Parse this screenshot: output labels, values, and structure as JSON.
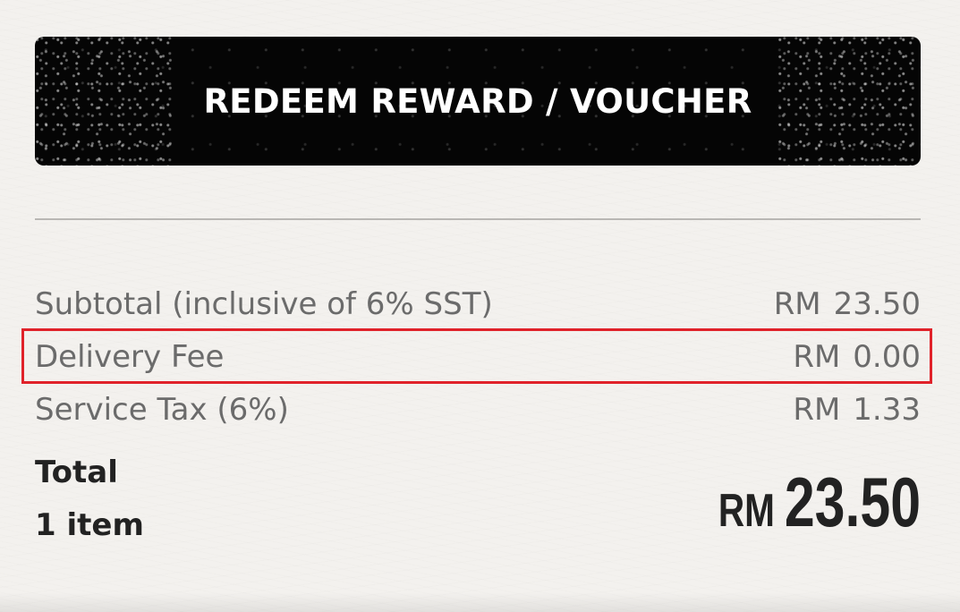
{
  "redeem": {
    "label": "REDEEM REWARD / VOUCHER"
  },
  "summary": {
    "subtotal": {
      "label": "Subtotal (inclusive of 6% SST)",
      "currency": "RM",
      "amount": "23.50"
    },
    "delivery_fee": {
      "label": "Delivery Fee",
      "currency": "RM",
      "amount": "0.00"
    },
    "service_tax": {
      "label": "Service Tax (6%)",
      "currency": "RM",
      "amount": "1.33"
    }
  },
  "total": {
    "label": "Total",
    "item_count": "1 item",
    "currency": "RM",
    "amount": "23.50"
  },
  "colors": {
    "background": "#f3f1ee",
    "button": "#050505",
    "highlight": "#e0222a",
    "muted_text": "#6b6b6b",
    "strong_text": "#222222"
  }
}
